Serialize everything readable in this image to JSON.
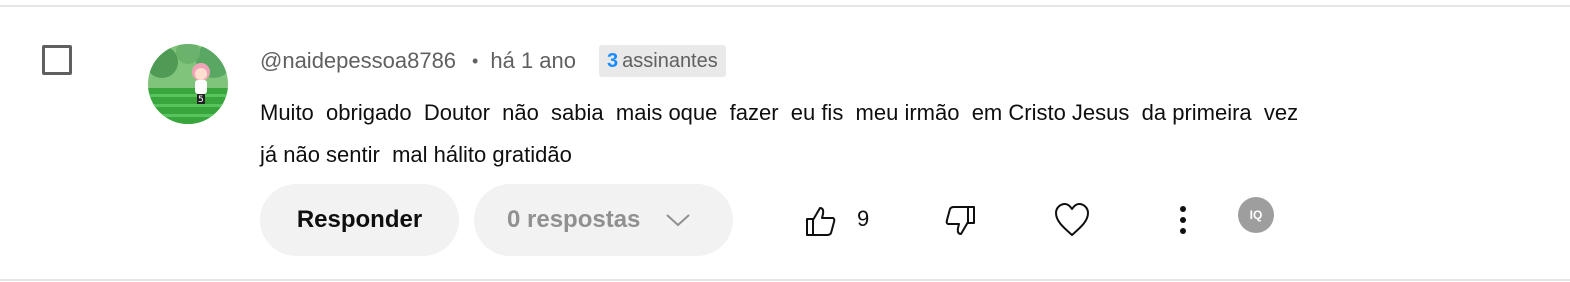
{
  "comment": {
    "author_handle": "@naidepessoa8786",
    "separator": "•",
    "time_ago": "há 1 ano",
    "badge": {
      "count": "3",
      "label": "assinantes"
    },
    "text": "Muito  obrigado  Doutor  não  sabia  mais oque  fazer  eu fis  meu irmão  em Cristo Jesus  da primeira  vez\njá não sentir  mal hálito gratidão",
    "avatar_icon": "avatar-anime-character"
  },
  "actions": {
    "reply_label": "Responder",
    "replies_label": "0 respostas",
    "replies_icon": "chevron-down-icon",
    "like_icon": "thumbs-up-icon",
    "like_count": "9",
    "dislike_icon": "thumbs-down-icon",
    "heart_icon": "heart-icon",
    "more_icon": "more-vertical-icon",
    "extension_badge": "IQ"
  },
  "colors": {
    "text_primary": "#0f0f0f",
    "text_secondary": "#606060",
    "badge_number": "#1a8cff",
    "button_bg": "#f2f2f2",
    "divider": "#e5e5e5"
  }
}
